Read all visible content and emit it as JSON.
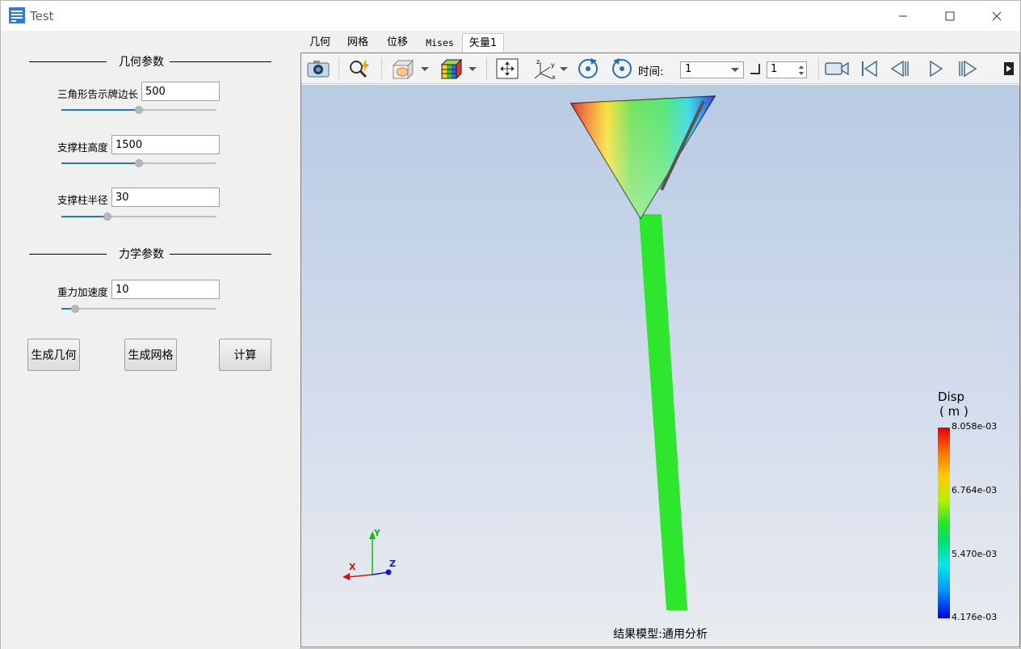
{
  "window": {
    "title": "Test",
    "minimize_symbol": "—",
    "maximize_symbol": "☐",
    "close_symbol": "✕"
  },
  "left_panel": {
    "geometry_section": "几何参数",
    "mechanics_section": "力学参数",
    "params": [
      {
        "label": "三角形告示牌边长",
        "value": "500",
        "slider_fraction": 0.5
      },
      {
        "label": "支撑柱高度",
        "value": "1500",
        "slider_fraction": 0.5
      },
      {
        "label": "支撑柱半径",
        "value": "30",
        "slider_fraction": 0.3
      }
    ],
    "gravity": {
      "label": "重力加速度",
      "value": "10",
      "slider_fraction": 0.09
    },
    "buttons": {
      "generate_geometry": "生成几何",
      "generate_mesh": "生成网格",
      "compute": "计算"
    }
  },
  "tabs": [
    "几何",
    "网格",
    "位移",
    "Mises",
    "矢量1"
  ],
  "active_tab": "矢量1",
  "toolbar": {
    "icons": [
      "camera-icon",
      "zoom-icon",
      "display-mode-icon",
      "color-cube-icon",
      "fit-view-icon",
      "axes-icon",
      "rotate-cw-icon",
      "rotate-ccw-icon",
      "record-icon",
      "first-frame-icon",
      "prev-frame-icon",
      "play-icon",
      "next-frame-icon"
    ],
    "time_label": "时间:",
    "time_value": "1",
    "step_value": "1"
  },
  "viewport": {
    "footer": "结果模型:通用分析",
    "triad": {
      "x": "X",
      "y": "Y",
      "z": "Z"
    },
    "legend": {
      "title": "Disp",
      "unit": "( m )",
      "ticks": [
        "8.058e-03",
        "6.764e-03",
        "5.470e-03",
        "4.176e-03"
      ]
    },
    "colors": {
      "red": "#e0000a",
      "green": "#2ee62e",
      "blue": "#0000e6",
      "cyan": "#00e8e8"
    }
  }
}
